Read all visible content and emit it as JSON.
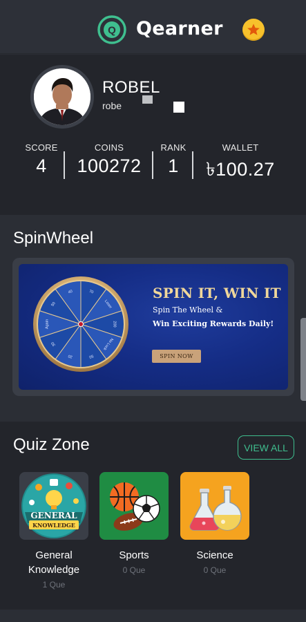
{
  "header": {
    "title": "Qearner",
    "logo_letter": "Q",
    "coin_icon": "star-icon"
  },
  "profile": {
    "name": "ROBEL",
    "handle": "robe",
    "stats": [
      {
        "label": "SCORE",
        "value": "4"
      },
      {
        "label": "COINS",
        "value": "100272"
      },
      {
        "label": "RANK",
        "value": "1"
      },
      {
        "label": "WALLET",
        "value": "৳100.27"
      }
    ]
  },
  "spinwheel": {
    "title": "SpinWheel",
    "banner": {
      "headline": "SPIN IT, WIN IT",
      "sub1": "Spin The Wheel &",
      "sub2": "Win Exciting Rewards Daily!",
      "button": "SPIN NOW",
      "segments": [
        "70",
        "Loser",
        "200",
        "No Luck",
        "50",
        "20",
        "30",
        "Again",
        "50",
        "40"
      ]
    }
  },
  "quiz_zone": {
    "title": "Quiz Zone",
    "view_all": "VIEW ALL",
    "categories": [
      {
        "name": "General Knowledge",
        "count": "1 Que",
        "badge": "GENERAL",
        "badge2": "KNOWLEDGE"
      },
      {
        "name": "Sports",
        "count": "0 Que"
      },
      {
        "name": "Science",
        "count": "0 Que"
      }
    ]
  },
  "colors": {
    "accent": "#3fbf8f",
    "coin": "#f7c12c",
    "banner_blue": "#152d86"
  }
}
